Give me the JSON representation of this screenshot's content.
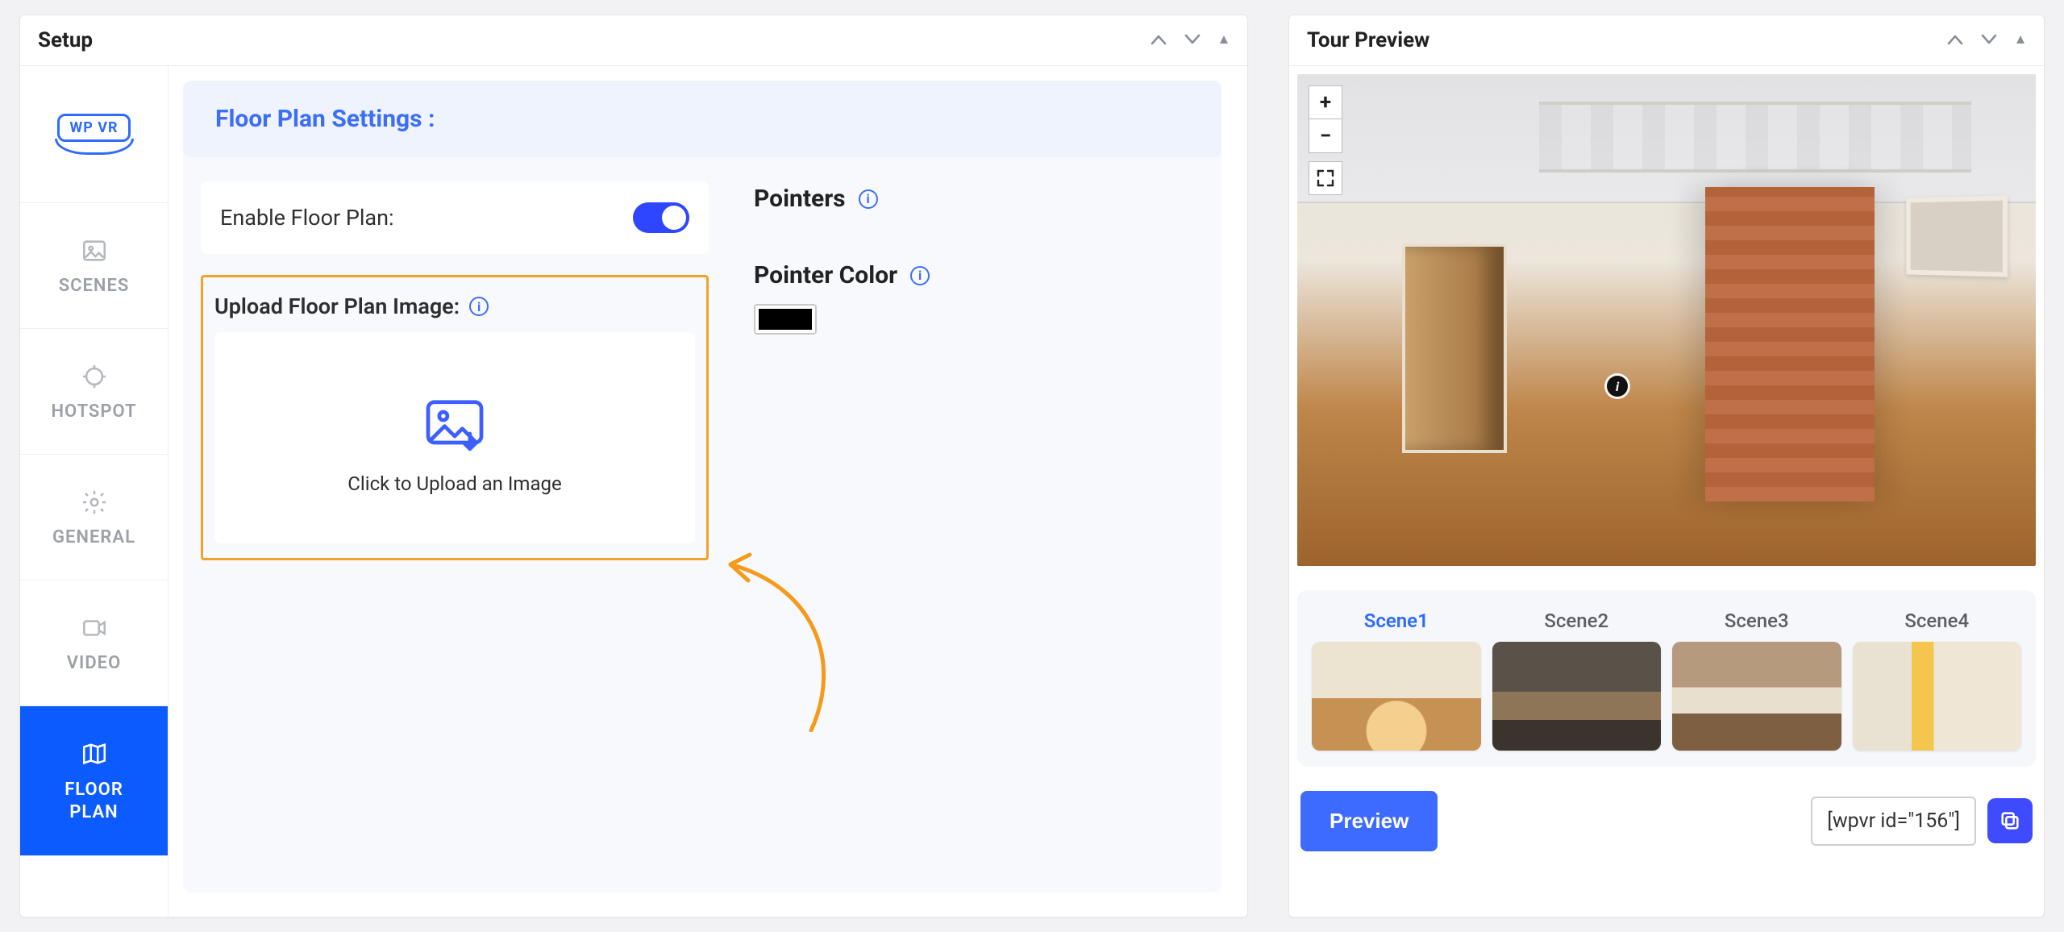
{
  "setup": {
    "title": "Setup",
    "logo_text": "WP VR",
    "nav": [
      {
        "label": "SCENES"
      },
      {
        "label": "HOTSPOT"
      },
      {
        "label": "GENERAL"
      },
      {
        "label": "VIDEO"
      },
      {
        "label_line1": "FLOOR",
        "label_line2": "PLAN"
      }
    ],
    "section_title": "Floor Plan Settings :",
    "enable_label": "Enable Floor Plan:",
    "enable_value": true,
    "upload_label": "Upload Floor Plan Image:",
    "upload_caption": "Click to Upload an Image",
    "pointers_label": "Pointers",
    "pointer_color_label": "Pointer Color",
    "pointer_color": "#000000"
  },
  "preview": {
    "title": "Tour Preview",
    "zoom_in": "+",
    "zoom_out": "−",
    "hotspot_info_symbol": "i",
    "scenes": [
      {
        "label": "Scene1"
      },
      {
        "label": "Scene2"
      },
      {
        "label": "Scene3"
      },
      {
        "label": "Scene4"
      }
    ],
    "preview_button": "Preview",
    "shortcode": "[wpvr id=\"156\"]"
  }
}
